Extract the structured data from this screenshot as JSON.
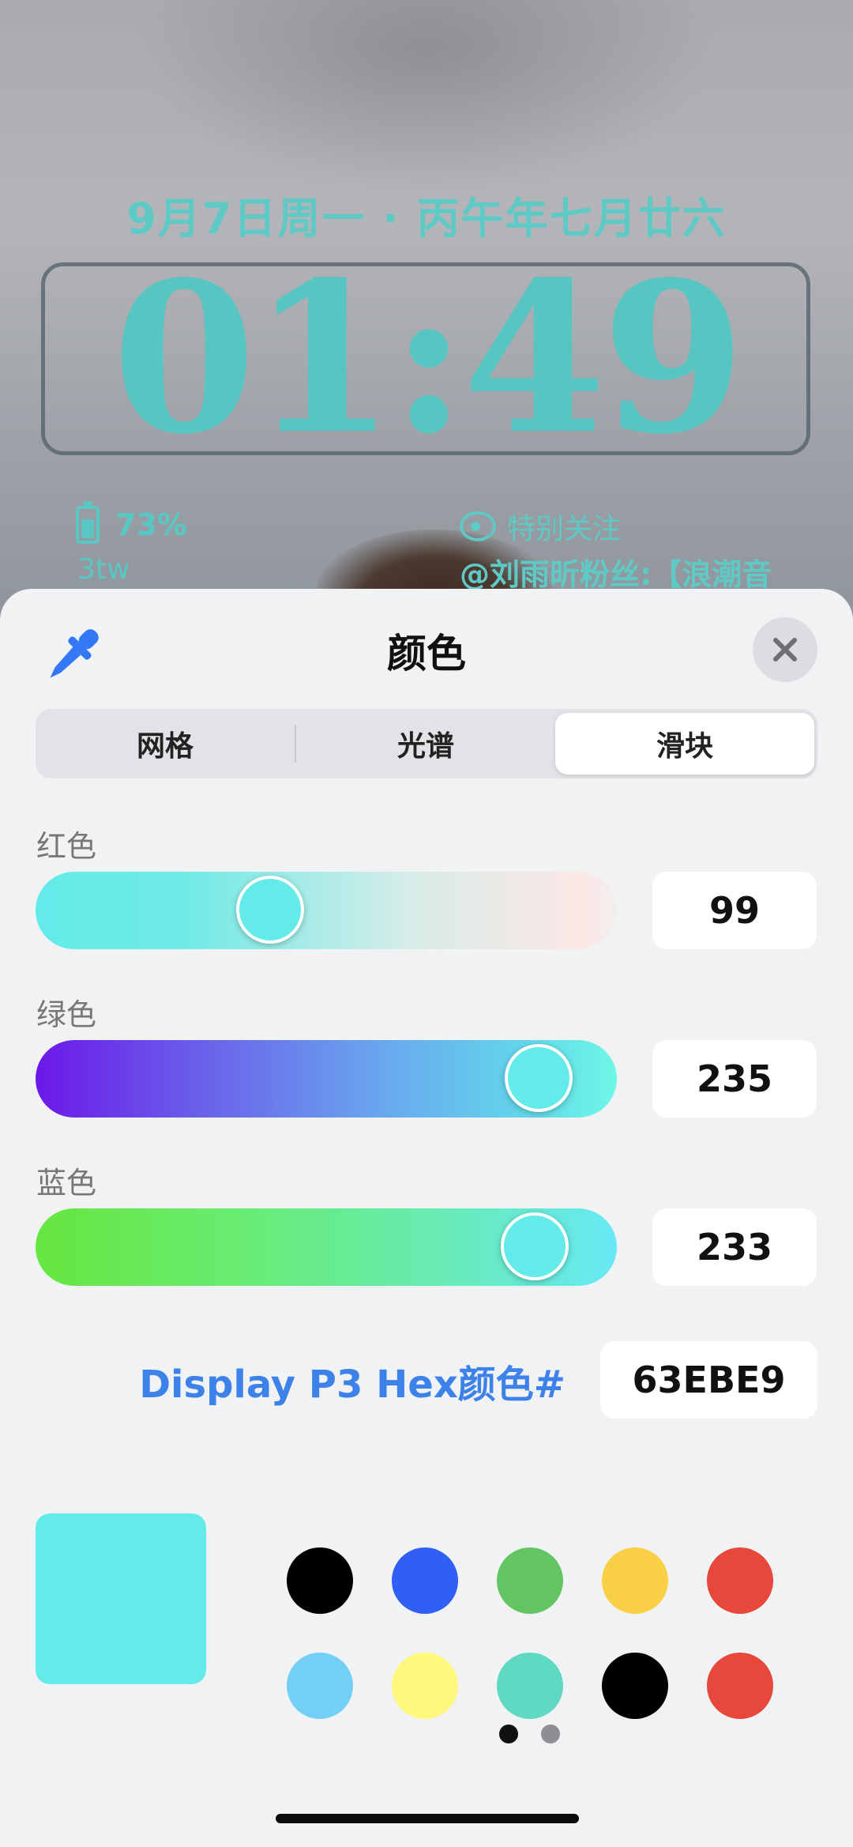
{
  "lockscreen": {
    "date_line": "9月7日周一 · 丙午年七月廿六",
    "time": "01:49",
    "battery_percent": "73%",
    "battery_sub": "3tw",
    "weibo_title": "特别关注",
    "weibo_text": "@刘雨昕粉丝:【浪潮音",
    "accent_color": "#5fc9c6"
  },
  "sheet": {
    "title": "颜色",
    "tabs": [
      {
        "label": "网格",
        "active": false
      },
      {
        "label": "光谱",
        "active": false
      },
      {
        "label": "滑块",
        "active": true
      }
    ],
    "sliders": {
      "red": {
        "label": "红色",
        "value": "99",
        "level": 0.388
      },
      "green": {
        "label": "绿色",
        "value": "235",
        "level": 0.922
      },
      "blue": {
        "label": "蓝色",
        "value": "233",
        "level": 0.914
      }
    },
    "hex_label": "Display P3 Hex颜色#",
    "hex_value": "63EBE9",
    "current_color": "#63ebe9",
    "swatches": [
      "#000000",
      "#2f5ff5",
      "#63c462",
      "#f8cf45",
      "#e8483b",
      "#74cff7",
      "#fff87c",
      "#5fd9c1",
      "#000000",
      "#e8483b"
    ],
    "page_dots": {
      "count": 2,
      "active_index": 0
    }
  }
}
